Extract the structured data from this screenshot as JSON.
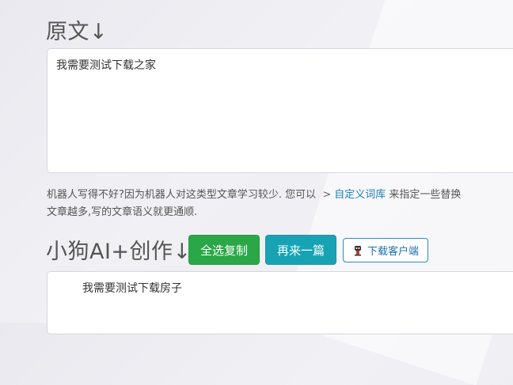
{
  "original": {
    "title": "原文↓",
    "text": "我需要测试下载之家"
  },
  "hint": {
    "prefix": "机器人写得不好?因为机器人对这类型文章学习较少. 您可以",
    "arrow": ">",
    "link": "自定义词库",
    "suffix": "来指定一些替换",
    "line2": "文章越多,写的文章语义就更通顺."
  },
  "ai": {
    "title": "小狗AI+创作↓",
    "output": "我需要测试下载房子"
  },
  "buttons": {
    "copy": "全选复制",
    "again": "再来一篇",
    "download": "下载客户端"
  },
  "colors": {
    "copy_button": "#2aa746",
    "again_button": "#18a3b5",
    "link": "#1e7fb8"
  }
}
